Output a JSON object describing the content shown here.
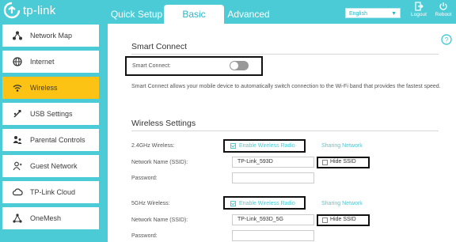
{
  "brand": {
    "logo_text": "tp-link",
    "accent": "#4acbd6",
    "active_nav": "#fcc214"
  },
  "header": {
    "tabs": [
      {
        "label": "Quick Setup",
        "active": false
      },
      {
        "label": "Basic",
        "active": true
      },
      {
        "label": "Advanced",
        "active": false
      }
    ],
    "language": {
      "selected": "English"
    },
    "logout_label": "Logout",
    "reboot_label": "Reboot"
  },
  "sidebar": {
    "items": [
      {
        "label": "Network Map",
        "icon": "network-map-icon"
      },
      {
        "label": "Internet",
        "icon": "globe-icon"
      },
      {
        "label": "Wireless",
        "icon": "wifi-icon",
        "active": true
      },
      {
        "label": "USB Settings",
        "icon": "usb-icon"
      },
      {
        "label": "Parental Controls",
        "icon": "parental-controls-icon"
      },
      {
        "label": "Guest Network",
        "icon": "guest-icon"
      },
      {
        "label": "TP-Link Cloud",
        "icon": "cloud-icon"
      },
      {
        "label": "OneMesh",
        "icon": "onemesh-icon"
      }
    ]
  },
  "smart_connect": {
    "title": "Smart Connect",
    "label": "Smart Connect:",
    "enabled": false,
    "description": "Smart Connect allows your mobile device to automatically switch connection to the Wi-Fi band that provides the fastest speed."
  },
  "wireless": {
    "title": "Wireless Settings",
    "band_24": {
      "label": "2.4GHz Wireless:",
      "enable_label": "Enable Wireless Radio",
      "enabled": true,
      "sharing_link": "Sharing Network",
      "ssid_label": "Network Name (SSID):",
      "ssid_value": "TP-Link_593D",
      "hide_ssid_label": "Hide SSID",
      "hide_ssid": false,
      "password_label": "Password:",
      "password_value": ""
    },
    "band_5": {
      "label": "5GHz Wireless:",
      "enable_label": "Enable Wireless Radio",
      "enabled": true,
      "sharing_link": "Sharing Network",
      "ssid_label": "Network Name (SSID):",
      "ssid_value": "TP-Link_593D_5G",
      "hide_ssid_label": "Hide SSID",
      "hide_ssid": false,
      "password_label": "Password:",
      "password_value": ""
    }
  }
}
